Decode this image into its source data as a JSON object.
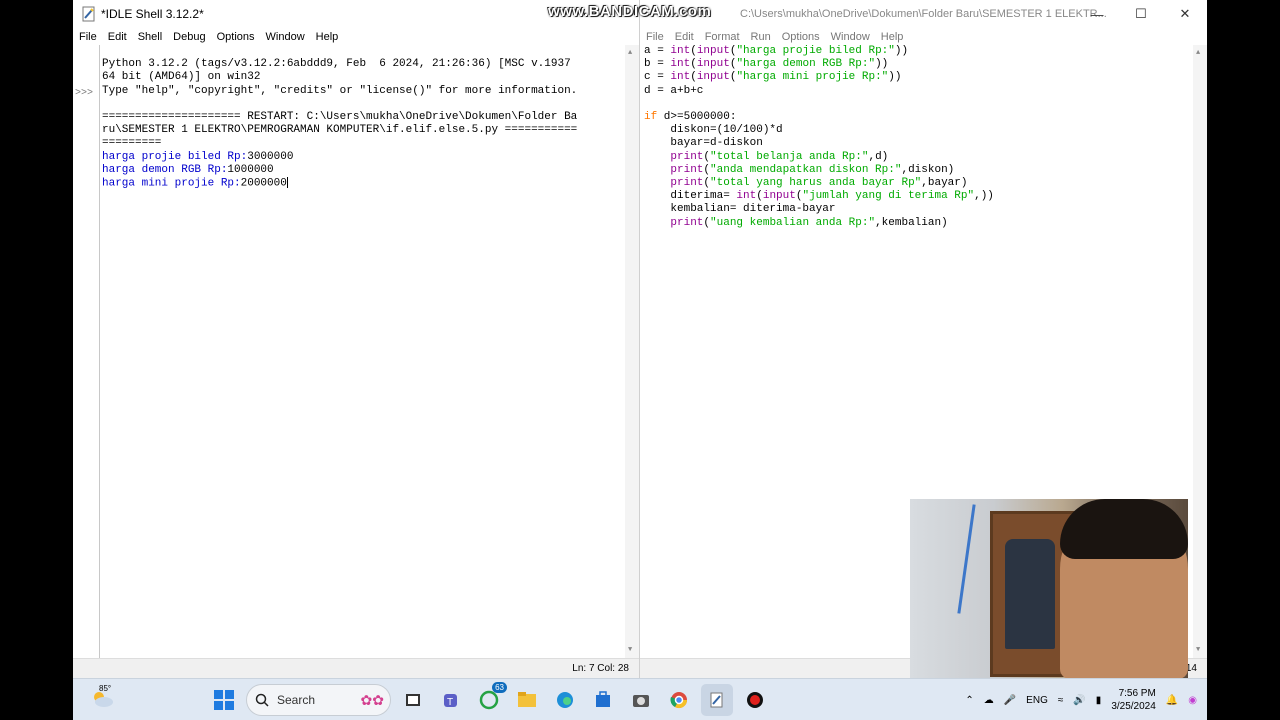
{
  "watermark": "www.BANDICAM.com",
  "shell": {
    "title": "*IDLE Shell 3.12.2*",
    "menu": [
      "File",
      "Edit",
      "Shell",
      "Debug",
      "Options",
      "Window",
      "Help"
    ],
    "prompt": ">>>",
    "header_lines": [
      "Python 3.12.2 (tags/v3.12.2:6abddd9, Feb  6 2024, 21:26:36) [MSC v.1937",
      "64 bit (AMD64)] on win32",
      "Type \"help\", \"copyright\", \"credits\" or \"license()\" for more information."
    ],
    "restart_lines": [
      "===================== RESTART: C:\\Users\\mukha\\OneDrive\\Dokumen\\Folder Ba",
      "ru\\SEMESTER 1 ELEKTRO\\PEMROGRAMAN KOMPUTER\\if.elif.else.5.py ===========",
      "========="
    ],
    "output_lines": [
      {
        "prompt": "harga projie biled Rp:",
        "value": "3000000"
      },
      {
        "prompt": "harga demon RGB Rp:",
        "value": "1000000"
      },
      {
        "prompt": "harga mini projie Rp:",
        "value": "2000000"
      }
    ],
    "status": "Ln: 7   Col: 28"
  },
  "editor": {
    "title": "C:\\Users\\mukha\\OneDrive\\Dokumen\\Folder Baru\\SEMESTER 1 ELEKTR...",
    "menu": [
      "File",
      "Edit",
      "Format",
      "Run",
      "Options",
      "Window",
      "Help"
    ],
    "code_lines": [
      "a = int(input(\"harga projie biled Rp:\"))",
      "b = int(input(\"harga demon RGB Rp:\"))",
      "c = int(input(\"harga mini projie Rp:\"))",
      "d = a+b+c",
      "",
      "if d>=5000000:",
      "    diskon=(10/100)*d",
      "    bayar=d-diskon",
      "    print(\"total belanja anda Rp:\",d)",
      "    print(\"anda mendapatkan diskon Rp:\",diskon)",
      "    print(\"total yang harus anda bayar Rp\",bayar)",
      "    diterima= int(input(\"jumlah yang di terima Rp\",))",
      "    kembalian= diterima-bayar",
      "    print(\"uang kembalian anda Rp:\",kembalian)"
    ],
    "status": ": 14"
  },
  "taskbar": {
    "temperature": "85°",
    "search_label": "Search",
    "whatsapp_badge": "63",
    "language": "ENG",
    "time": "7:56 PM",
    "date": "3/25/2024",
    "icons": [
      "windows-start-icon",
      "search-icon",
      "widgets-icon",
      "file-explorer-taskview-icon",
      "teams-icon",
      "whatsapp-icon",
      "folder-icon",
      "edge-icon",
      "store-icon",
      "camera-icon",
      "chrome-icon",
      "idle-icon",
      "record-icon"
    ]
  }
}
